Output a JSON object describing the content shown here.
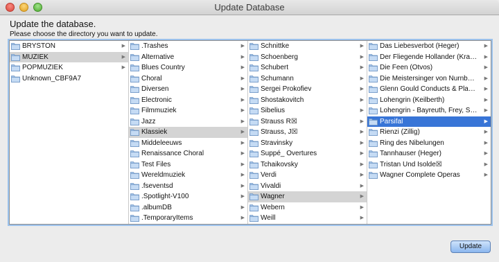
{
  "window": {
    "title": "Update Database"
  },
  "heading": "Update the database.",
  "subheading": "Please choose the directory you want to update.",
  "update_button": "Update",
  "columns": [
    {
      "items": [
        {
          "label": "BRYSTON",
          "arrow": true,
          "state": ""
        },
        {
          "label": "MUZIEK",
          "arrow": true,
          "state": "inactive"
        },
        {
          "label": "POPMUZIEK",
          "arrow": true,
          "state": ""
        },
        {
          "label": "Unknown_CBF9A7",
          "arrow": false,
          "state": ""
        }
      ]
    },
    {
      "items": [
        {
          "label": ".Trashes",
          "arrow": true,
          "state": ""
        },
        {
          "label": "Alternative",
          "arrow": true,
          "state": ""
        },
        {
          "label": "Blues Country",
          "arrow": true,
          "state": ""
        },
        {
          "label": "Choral",
          "arrow": true,
          "state": ""
        },
        {
          "label": "Diversen",
          "arrow": true,
          "state": ""
        },
        {
          "label": "Electronic",
          "arrow": true,
          "state": ""
        },
        {
          "label": "Filmmuziek",
          "arrow": true,
          "state": ""
        },
        {
          "label": "Jazz",
          "arrow": true,
          "state": ""
        },
        {
          "label": "Klassiek",
          "arrow": true,
          "state": "inactive"
        },
        {
          "label": "Middeleeuws",
          "arrow": true,
          "state": ""
        },
        {
          "label": "Renaissance Choral",
          "arrow": true,
          "state": ""
        },
        {
          "label": "Test Files",
          "arrow": true,
          "state": ""
        },
        {
          "label": "Wereldmuziek",
          "arrow": true,
          "state": ""
        },
        {
          "label": ".fseventsd",
          "arrow": true,
          "state": ""
        },
        {
          "label": ".Spotlight-V100",
          "arrow": true,
          "state": ""
        },
        {
          "label": ".albumDB",
          "arrow": true,
          "state": ""
        },
        {
          "label": ".TemporaryItems",
          "arrow": true,
          "state": ""
        }
      ]
    },
    {
      "items": [
        {
          "label": "Schnittke",
          "arrow": true,
          "state": ""
        },
        {
          "label": "Schoenberg",
          "arrow": true,
          "state": ""
        },
        {
          "label": "Schubert",
          "arrow": true,
          "state": ""
        },
        {
          "label": "Schumann",
          "arrow": true,
          "state": ""
        },
        {
          "label": "Sergei Prokofiev",
          "arrow": true,
          "state": ""
        },
        {
          "label": "Shostakovitch",
          "arrow": true,
          "state": ""
        },
        {
          "label": "Sibelius",
          "arrow": true,
          "state": ""
        },
        {
          "label": "Strauss R☒",
          "arrow": true,
          "state": ""
        },
        {
          "label": "Strauss, J☒",
          "arrow": true,
          "state": ""
        },
        {
          "label": "Stravinsky",
          "arrow": true,
          "state": ""
        },
        {
          "label": "Suppé_ Overtures",
          "arrow": true,
          "state": ""
        },
        {
          "label": "Tchaikovsky",
          "arrow": true,
          "state": ""
        },
        {
          "label": "Verdi",
          "arrow": true,
          "state": ""
        },
        {
          "label": "Vivaldi",
          "arrow": true,
          "state": ""
        },
        {
          "label": "Wagner",
          "arrow": true,
          "state": "inactive"
        },
        {
          "label": "Webern",
          "arrow": true,
          "state": ""
        },
        {
          "label": "Weill",
          "arrow": true,
          "state": ""
        }
      ]
    },
    {
      "items": [
        {
          "label": "Das Liebesverbot (Heger)",
          "arrow": true,
          "state": ""
        },
        {
          "label": "Der Fliegende Hollander (Krauss)",
          "arrow": true,
          "state": ""
        },
        {
          "label": "Die Feen (Otvos)",
          "arrow": true,
          "state": ""
        },
        {
          "label": "Die Meistersinger von Nurnber…",
          "arrow": true,
          "state": ""
        },
        {
          "label": "Glenn Gould Conducts & Plays W…",
          "arrow": true,
          "state": ""
        },
        {
          "label": "Lohengrin (Keilberth)",
          "arrow": true,
          "state": ""
        },
        {
          "label": "Lohengrin - Bayreuth, Frey, St…",
          "arrow": true,
          "state": ""
        },
        {
          "label": "Parsifal",
          "arrow": true,
          "state": "active"
        },
        {
          "label": "Rienzi (Zillig)",
          "arrow": true,
          "state": ""
        },
        {
          "label": "Ring des Nibelungen",
          "arrow": true,
          "state": ""
        },
        {
          "label": "Tannhauser (Heger)",
          "arrow": true,
          "state": ""
        },
        {
          "label": "Tristan Und Isolde☒",
          "arrow": true,
          "state": ""
        },
        {
          "label": "Wagner Complete Operas",
          "arrow": true,
          "state": ""
        }
      ]
    }
  ]
}
